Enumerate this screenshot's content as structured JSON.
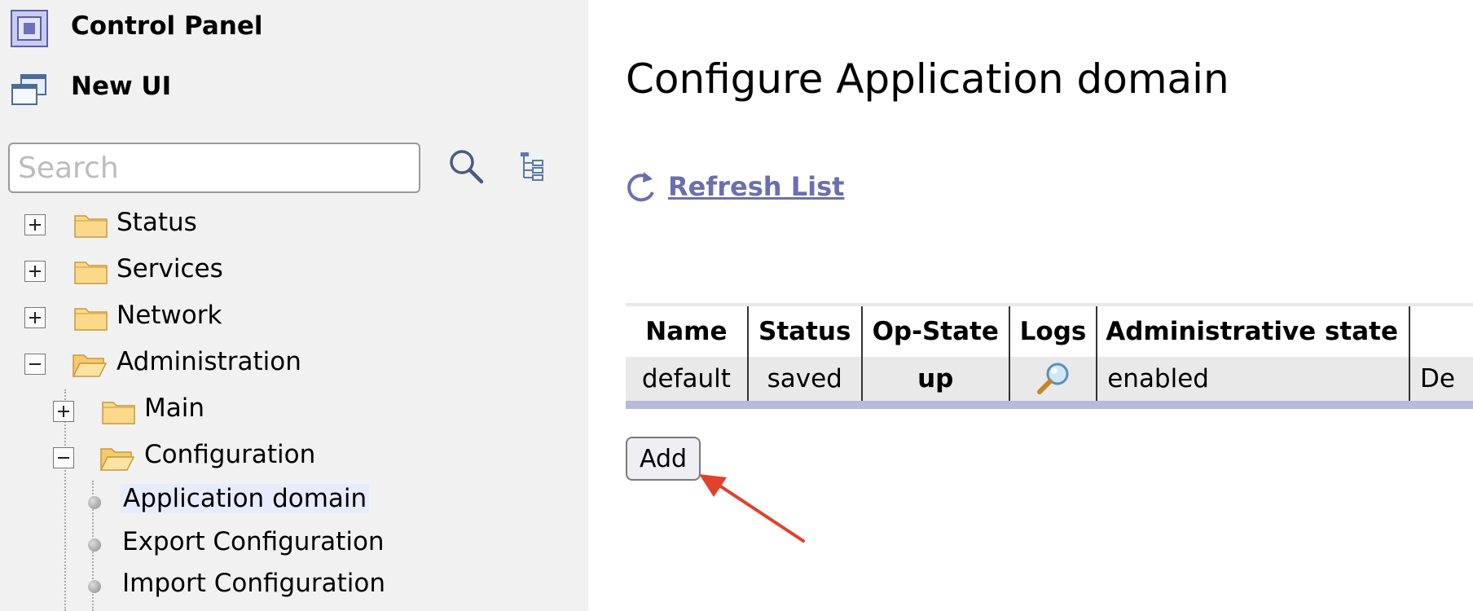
{
  "sidebar": {
    "control_panel_label": "Control Panel",
    "new_ui_label": "New UI",
    "search": {
      "placeholder": "Search",
      "value": ""
    },
    "tree": {
      "status": "Status",
      "services": "Services",
      "network": "Network",
      "administration": "Administration",
      "main": "Main",
      "configuration": "Configuration",
      "application_domain": "Application domain",
      "export_configuration": "Export Configuration",
      "import_configuration": "Import Configuration"
    }
  },
  "main": {
    "title": "Configure Application domain",
    "refresh_label": "Refresh List",
    "table": {
      "headers": [
        "Name",
        "Status",
        "Op-State",
        "Logs",
        "Administrative state",
        ""
      ],
      "rows": [
        {
          "name": "default",
          "status": "saved",
          "op_state": "up",
          "logs_icon": "magnifier-icon",
          "admin_state": "enabled",
          "extra": "De"
        }
      ]
    },
    "add_label": "Add"
  },
  "colors": {
    "sidebar_bg": "#f1f1f1",
    "link": "#6b6fb0",
    "table_row_bg": "#e9e9e9",
    "table_accent": "#b7bada",
    "arrow": "#e2412b",
    "selected_bg": "#e6ecfb"
  }
}
